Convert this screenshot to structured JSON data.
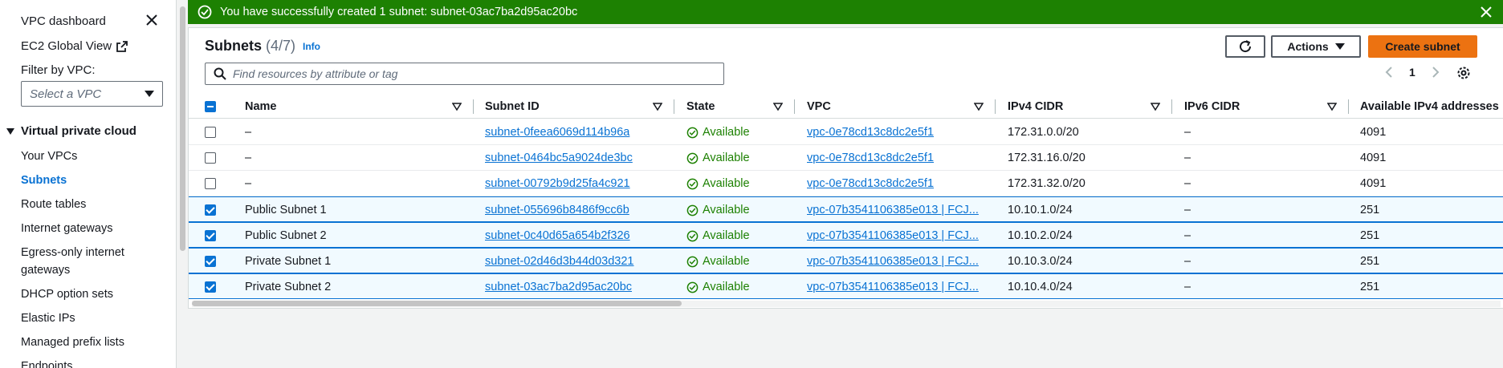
{
  "sidebar": {
    "dashboard": "VPC dashboard",
    "ec2_global": "EC2 Global View",
    "filter_label": "Filter by VPC:",
    "filter_placeholder": "Select a VPC",
    "section": "Virtual private cloud",
    "items": [
      {
        "label": "Your VPCs",
        "active": false
      },
      {
        "label": "Subnets",
        "active": true
      },
      {
        "label": "Route tables",
        "active": false
      },
      {
        "label": "Internet gateways",
        "active": false
      },
      {
        "label": "Egress-only internet",
        "active": false
      },
      {
        "label": "gateways",
        "active": false
      },
      {
        "label": "DHCP option sets",
        "active": false
      },
      {
        "label": "Elastic IPs",
        "active": false
      },
      {
        "label": "Managed prefix lists",
        "active": false
      },
      {
        "label": "Endpoints",
        "active": false
      }
    ]
  },
  "flash": {
    "message": "You have successfully created 1 subnet: subnet-03ac7ba2d95ac20bc",
    "color": "#1d8102"
  },
  "panel": {
    "title": "Subnets",
    "count": "(4/7)",
    "info": "Info",
    "actions": "Actions",
    "create": "Create subnet",
    "search_placeholder": "Find resources by attribute or tag",
    "page": "1"
  },
  "table": {
    "columns": [
      "Name",
      "Subnet ID",
      "State",
      "VPC",
      "IPv4 CIDR",
      "IPv6 CIDR",
      "Available IPv4 addresses"
    ],
    "rows": [
      {
        "selected": false,
        "name": "–",
        "subnet_id": "subnet-0feea6069d114b96a",
        "state": "Available",
        "vpc": "vpc-0e78cd13c8dc2e5f1",
        "ipv4": "172.31.0.0/20",
        "ipv6": "–",
        "avail": "4091"
      },
      {
        "selected": false,
        "name": "–",
        "subnet_id": "subnet-0464bc5a9024de3bc",
        "state": "Available",
        "vpc": "vpc-0e78cd13c8dc2e5f1",
        "ipv4": "172.31.16.0/20",
        "ipv6": "–",
        "avail": "4091"
      },
      {
        "selected": false,
        "name": "–",
        "subnet_id": "subnet-00792b9d25fa4c921",
        "state": "Available",
        "vpc": "vpc-0e78cd13c8dc2e5f1",
        "ipv4": "172.31.32.0/20",
        "ipv6": "–",
        "avail": "4091"
      },
      {
        "selected": true,
        "name": "Public Subnet 1",
        "subnet_id": "subnet-055696b8486f9cc6b",
        "state": "Available",
        "vpc": "vpc-07b3541106385e013 | FCJ...",
        "ipv4": "10.10.1.0/24",
        "ipv6": "–",
        "avail": "251"
      },
      {
        "selected": true,
        "name": "Public Subnet 2",
        "subnet_id": "subnet-0c40d65a654b2f326",
        "state": "Available",
        "vpc": "vpc-07b3541106385e013 | FCJ...",
        "ipv4": "10.10.2.0/24",
        "ipv6": "–",
        "avail": "251"
      },
      {
        "selected": true,
        "name": "Private Subnet 1",
        "subnet_id": "subnet-02d46d3b44d03d321",
        "state": "Available",
        "vpc": "vpc-07b3541106385e013 | FCJ...",
        "ipv4": "10.10.3.0/24",
        "ipv6": "–",
        "avail": "251"
      },
      {
        "selected": true,
        "name": "Private Subnet 2",
        "subnet_id": "subnet-03ac7ba2d95ac20bc",
        "state": "Available",
        "vpc": "vpc-07b3541106385e013 | FCJ...",
        "ipv4": "10.10.4.0/24",
        "ipv6": "–",
        "avail": "251"
      }
    ]
  },
  "colors": {
    "accent": "#0972d3",
    "primary_button": "#ec7211",
    "success": "#1d8102"
  }
}
